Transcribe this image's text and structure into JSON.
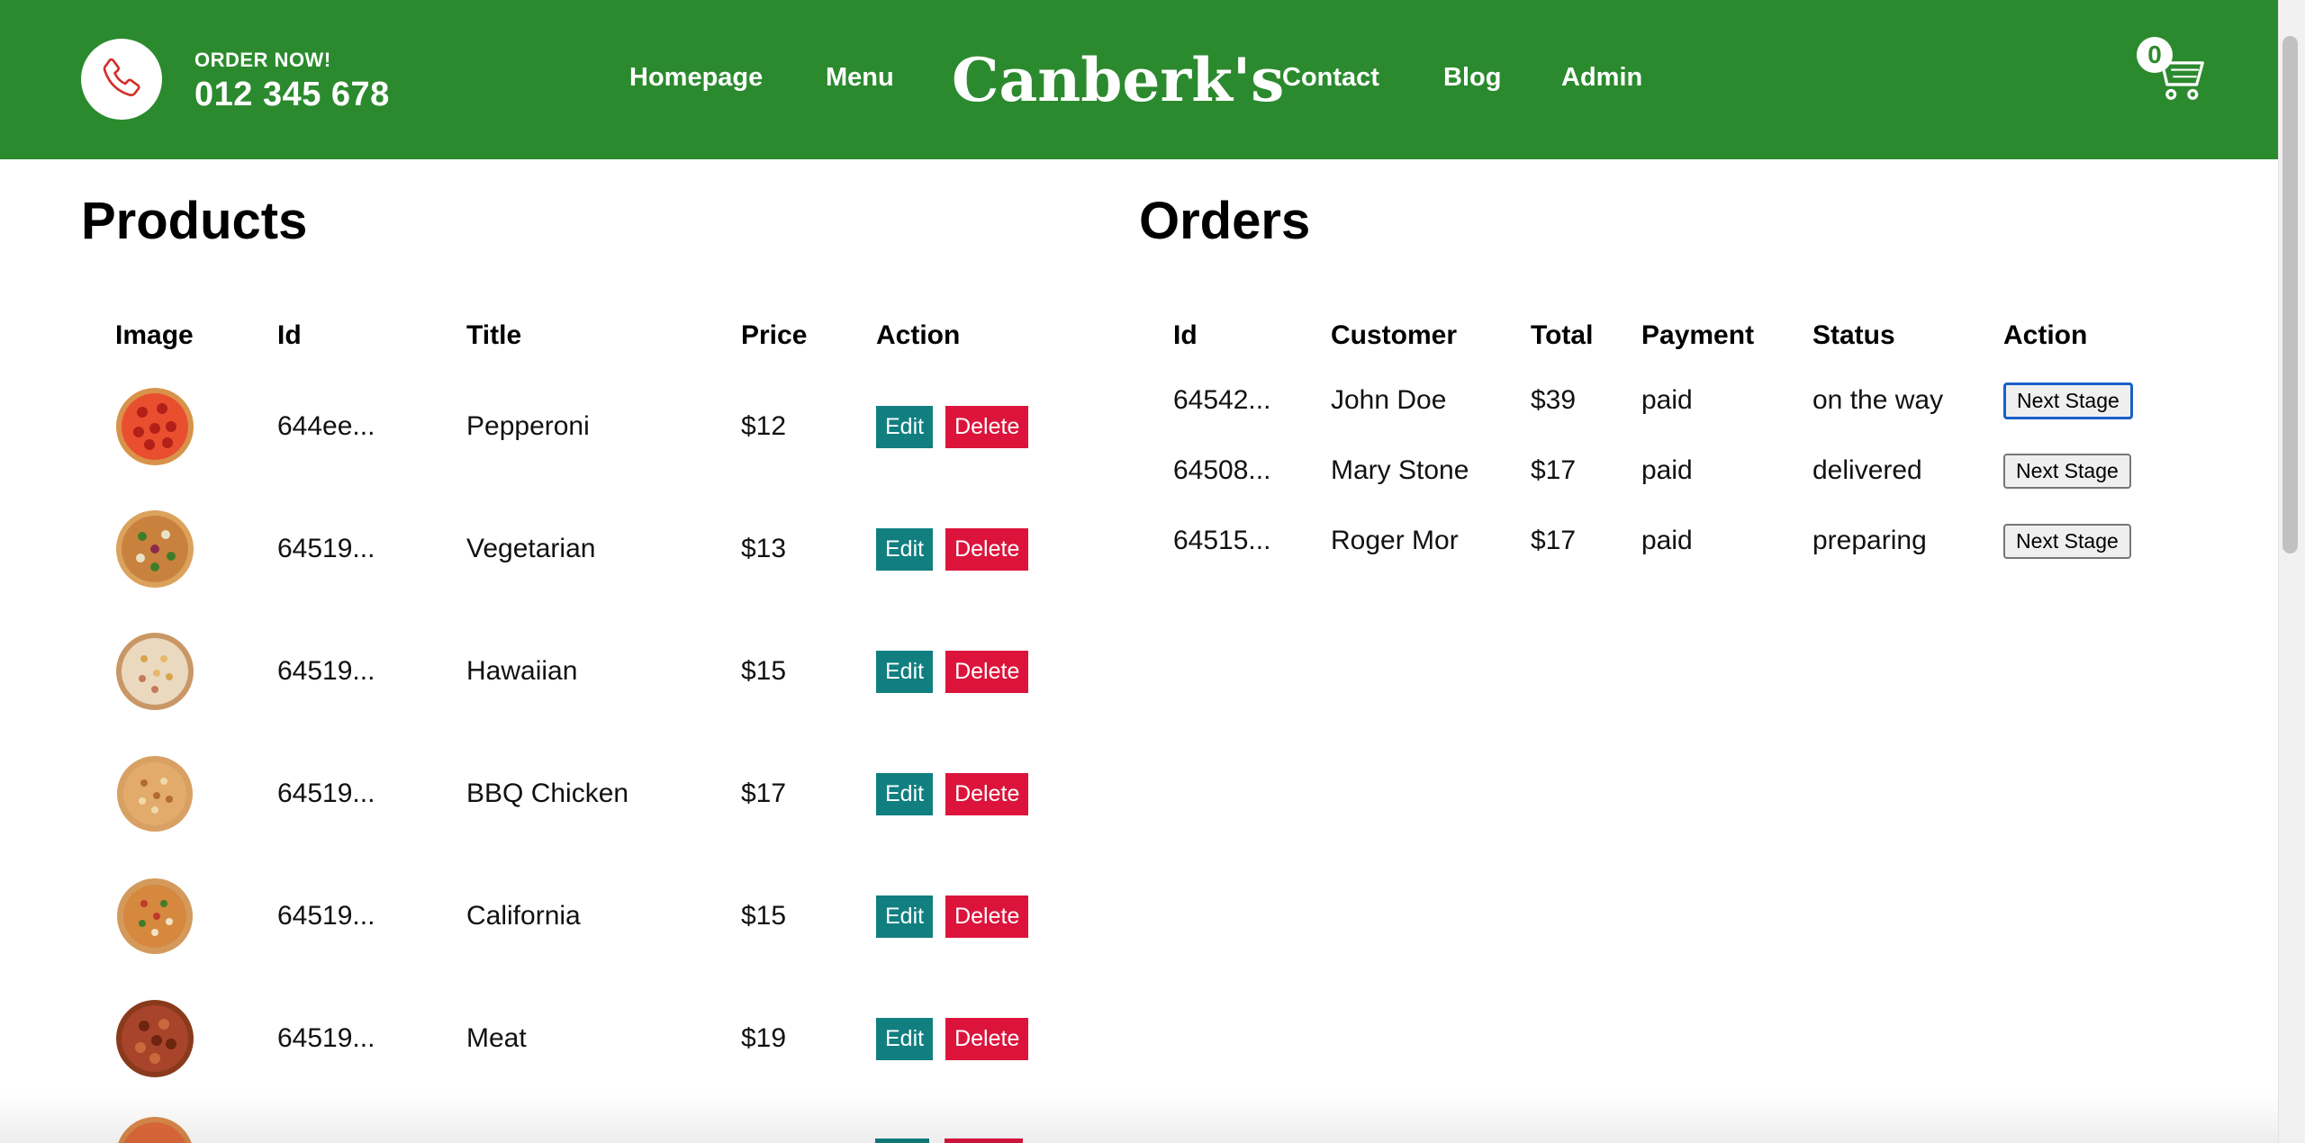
{
  "header": {
    "order_now": "ORDER NOW!",
    "phone": "012 345 678",
    "nav": {
      "homepage": "Homepage",
      "menu": "Menu",
      "logo": "Canberk's",
      "contact": "Contact",
      "blog": "Blog",
      "admin": "Admin"
    },
    "cart_count": "0"
  },
  "colors": {
    "brand_green": "#2b8a2e",
    "edit_teal": "#117f80",
    "delete_red": "#dc143c",
    "focus_blue": "#1a5fc9"
  },
  "products": {
    "title": "Products",
    "columns": [
      "Image",
      "Id",
      "Title",
      "Price",
      "Action"
    ],
    "edit_label": "Edit",
    "delete_label": "Delete",
    "rows": [
      {
        "id": "644ee...",
        "title": "Pepperoni",
        "price": "$12",
        "pizza_icon": "pepperoni-pizza-icon"
      },
      {
        "id": "64519...",
        "title": "Vegetarian",
        "price": "$13",
        "pizza_icon": "vegetarian-pizza-icon"
      },
      {
        "id": "64519...",
        "title": "Hawaiian",
        "price": "$15",
        "pizza_icon": "hawaiian-pizza-icon"
      },
      {
        "id": "64519...",
        "title": "BBQ Chicken",
        "price": "$17",
        "pizza_icon": "bbq-chicken-pizza-icon"
      },
      {
        "id": "64519...",
        "title": "California",
        "price": "$15",
        "pizza_icon": "california-pizza-icon"
      },
      {
        "id": "64519...",
        "title": "Meat",
        "price": "$19",
        "pizza_icon": "meat-pizza-icon"
      }
    ]
  },
  "orders": {
    "title": "Orders",
    "columns": [
      "Id",
      "Customer",
      "Total",
      "Payment",
      "Status",
      "Action"
    ],
    "next_stage_label": "Next Stage",
    "rows": [
      {
        "id": "64542...",
        "customer": "John Doe",
        "total": "$39",
        "payment": "paid",
        "status": "on the way"
      },
      {
        "id": "64508...",
        "customer": "Mary Stone",
        "total": "$17",
        "payment": "paid",
        "status": "delivered"
      },
      {
        "id": "64515...",
        "customer": "Roger Mor",
        "total": "$17",
        "payment": "paid",
        "status": "preparing"
      }
    ]
  }
}
